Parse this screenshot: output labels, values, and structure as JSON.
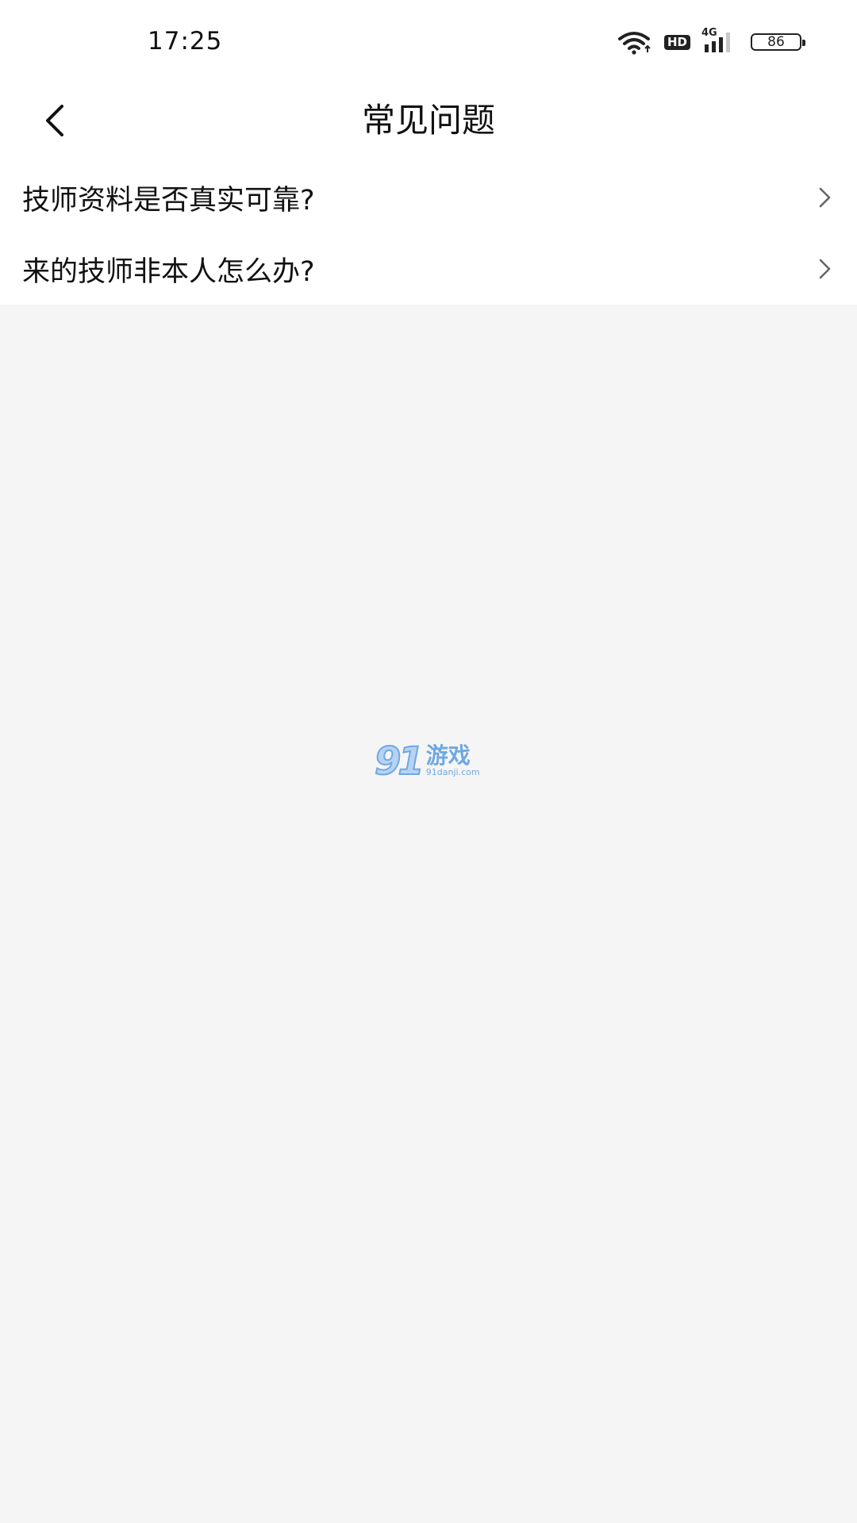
{
  "status_bar": {
    "time": "17:25",
    "hd_badge": "HD",
    "network": "4G",
    "battery": "86"
  },
  "nav": {
    "title": "常见问题",
    "back_icon": "chevron-left-icon"
  },
  "faq": {
    "items": [
      {
        "label": "技师资料是否真实可靠?"
      },
      {
        "label": "来的技师非本人怎么办?"
      }
    ],
    "arrow_icon": "chevron-right-icon"
  },
  "watermark": {
    "number": "91",
    "text": "游戏",
    "url": "91danji.com"
  },
  "colors": {
    "background": "#f5f5f5",
    "surface": "#ffffff",
    "text": "#111111",
    "arrow": "#666666",
    "watermark": "#6fa8e2"
  }
}
